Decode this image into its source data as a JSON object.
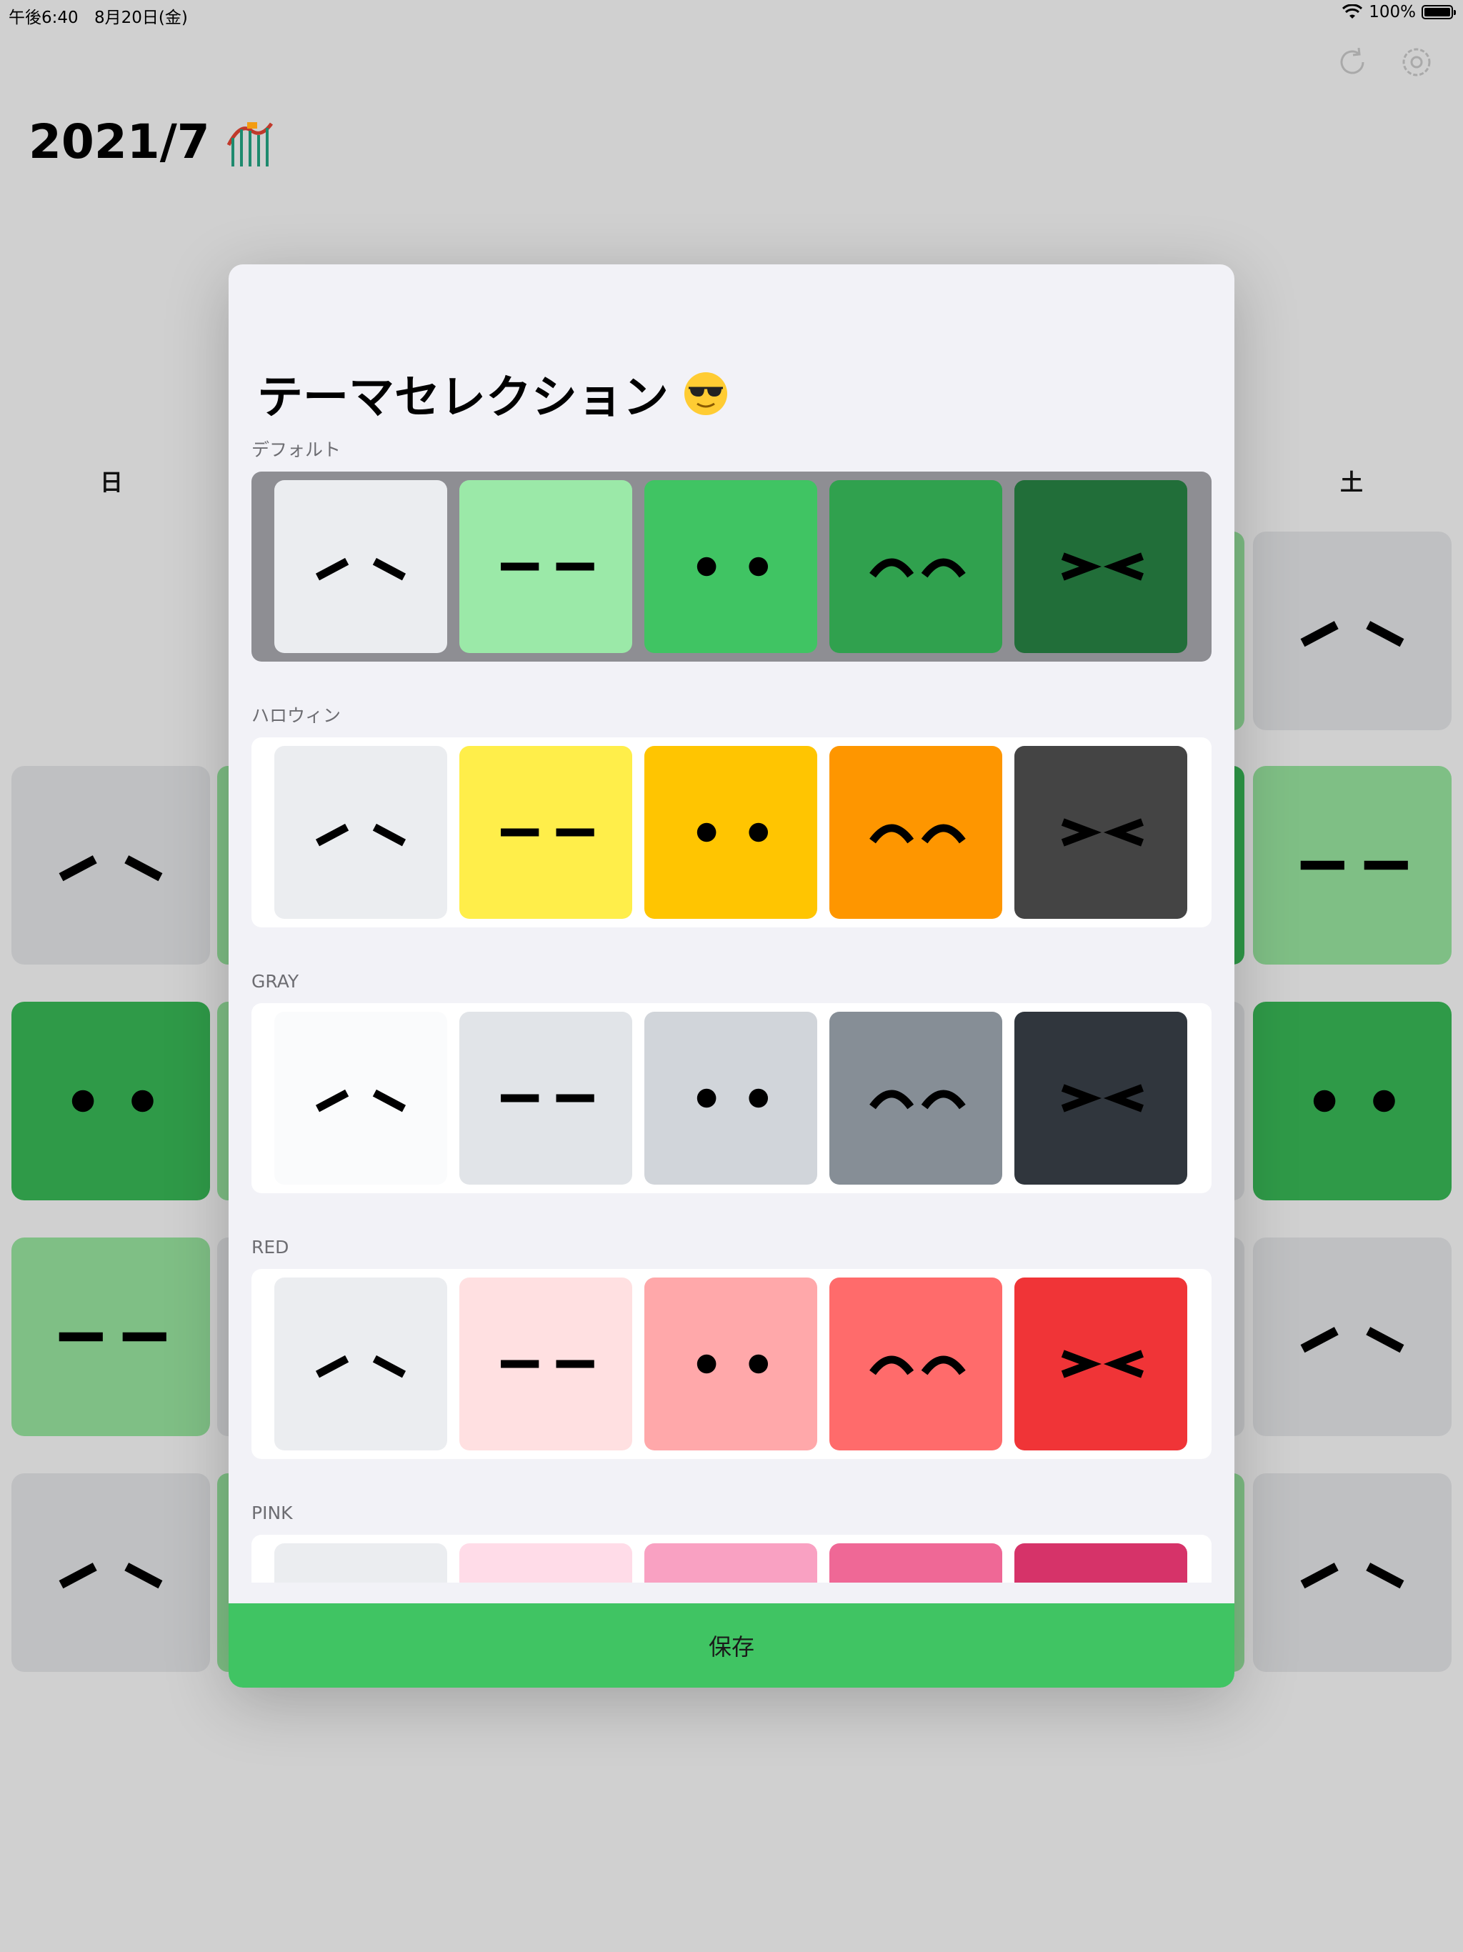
{
  "status_bar": {
    "time": "午後6:40",
    "date": "8月20日(金)",
    "battery": "100%"
  },
  "header": {
    "title": "2021/7",
    "title_icon": "roller-coaster-icon",
    "icons": [
      "refresh-icon",
      "settings-icon"
    ]
  },
  "calendar": {
    "weekday_sun": "日",
    "weekday_sat": "土",
    "left_column": [
      {
        "face": "slant",
        "color": "#bfc0c2"
      },
      {
        "face": "dots",
        "color": "#2f9a48"
      },
      {
        "face": "dash",
        "color": "#7fbf85"
      },
      {
        "face": "slant",
        "color": "#bfc0c2"
      }
    ],
    "right_column": [
      {
        "face": "slant",
        "color": "#bfc0c2"
      },
      {
        "face": "dash",
        "color": "#7fbf85"
      },
      {
        "face": "dots",
        "color": "#2f9a48"
      },
      {
        "face": "slant",
        "color": "#bfc0c2"
      },
      {
        "face": "slant",
        "color": "#bfc0c2"
      }
    ]
  },
  "modal": {
    "title": "テーマセレクション",
    "title_icon": "sunglasses-face-icon",
    "save_label": "保存",
    "themes": [
      {
        "label": "デフォルト",
        "selected": true,
        "colors": [
          "#ebedf0",
          "#9be9a8",
          "#40c463",
          "#30a14e",
          "#216e39"
        ]
      },
      {
        "label": "ハロウィン",
        "selected": false,
        "colors": [
          "#ebedf0",
          "#ffee4a",
          "#ffc501",
          "#fe9600",
          "#444444"
        ]
      },
      {
        "label": "GRAY",
        "selected": false,
        "colors": [
          "#fafbfc",
          "#e1e4e8",
          "#d1d5da",
          "#868e96",
          "#30363d"
        ]
      },
      {
        "label": "RED",
        "selected": false,
        "colors": [
          "#ebedf0",
          "#ffe0e1",
          "#ffa8aa",
          "#ff6b6b",
          "#f03437"
        ]
      },
      {
        "label": "PINK",
        "selected": false,
        "colors": [
          "#ebedf0",
          "#ffdce8",
          "#f9a1c2",
          "#ef6896",
          "#d63369"
        ]
      }
    ],
    "faces": [
      "slant",
      "dash",
      "dots",
      "arc",
      "angle"
    ]
  }
}
